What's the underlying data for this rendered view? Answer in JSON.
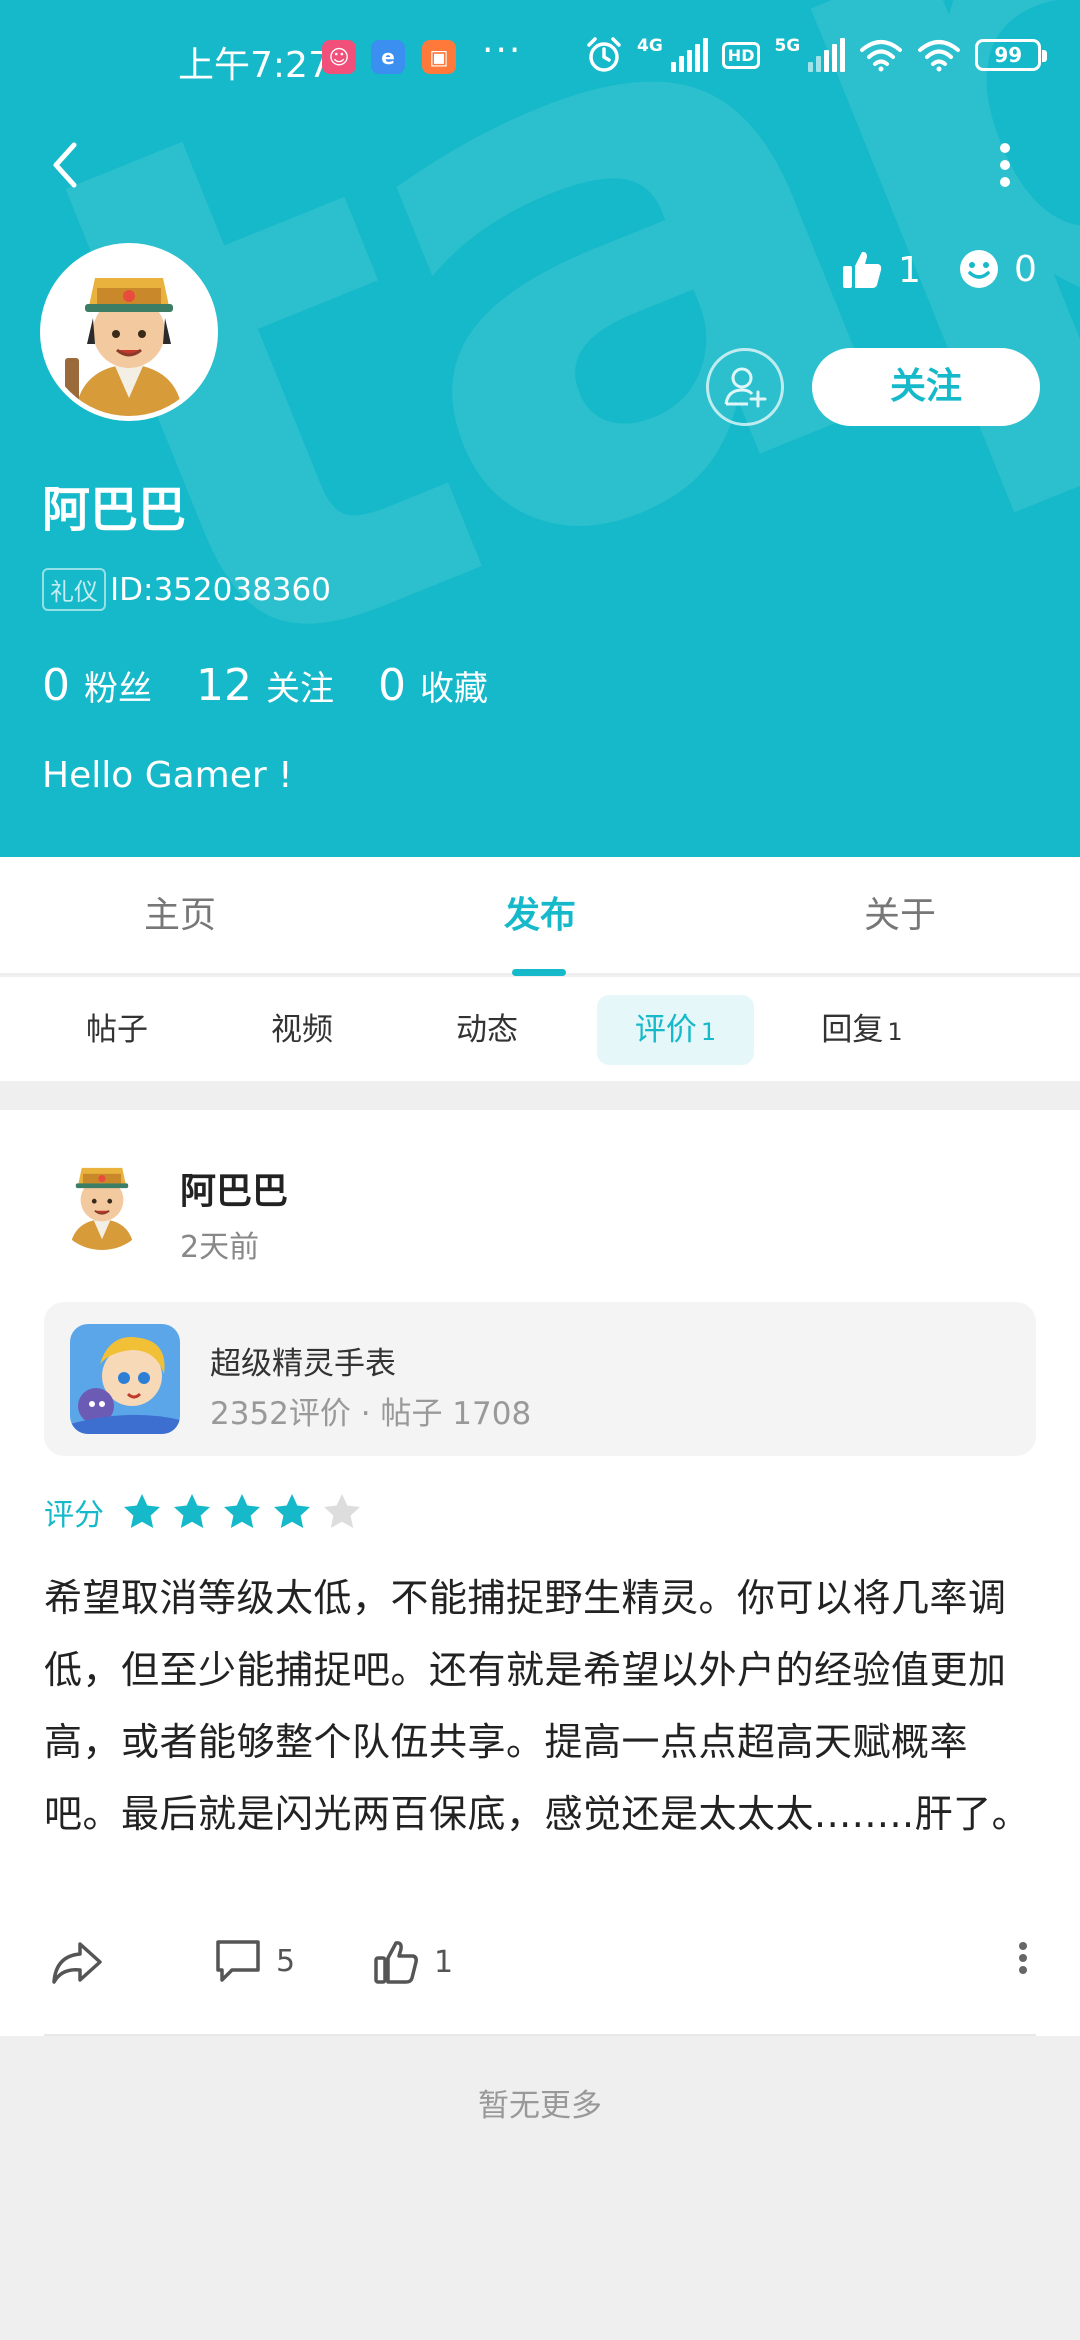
{
  "status_bar": {
    "time": "上午7:27",
    "more": "···",
    "net1": "4G",
    "hd": "HD",
    "net2": "5G",
    "battery": "99"
  },
  "profile": {
    "name": "阿巴巴",
    "id_tag": "礼仪",
    "id_text": "ID:352038360",
    "likes": "1",
    "smiles": "0",
    "follow_label": "关注",
    "bio": "Hello Gamer !",
    "counts": [
      {
        "value": "0",
        "label": "粉丝"
      },
      {
        "value": "12",
        "label": "关注"
      },
      {
        "value": "0",
        "label": "收藏"
      }
    ]
  },
  "main_tabs": [
    {
      "label": "主页"
    },
    {
      "label": "发布"
    },
    {
      "label": "关于"
    }
  ],
  "sub_tabs": [
    {
      "label": "帖子",
      "count": ""
    },
    {
      "label": "视频",
      "count": ""
    },
    {
      "label": "动态",
      "count": ""
    },
    {
      "label": "评价",
      "count": "1"
    },
    {
      "label": "回复",
      "count": "1"
    }
  ],
  "post": {
    "author": "阿巴巴",
    "time": "2天前",
    "game": {
      "name": "超级精灵手表",
      "meta": "2352评价  ·  帖子 1708"
    },
    "rating_label": "评分",
    "rating": 4,
    "rating_max": 5,
    "text": "希望取消等级太低，不能捕捉野生精灵。你可以将几率调低，但至少能捕捉吧。还有就是希望以外户的经验值更加高，或者能够整个队伍共享。提高一点点超高天赋概率吧。最后就是闪光两百保底，感觉还是太太太........肝了。",
    "comments": "5",
    "likes": "1"
  },
  "footer": {
    "no_more": "暂无更多"
  },
  "colors": {
    "accent": "#15b9c9",
    "star_empty": "#dddddd"
  }
}
